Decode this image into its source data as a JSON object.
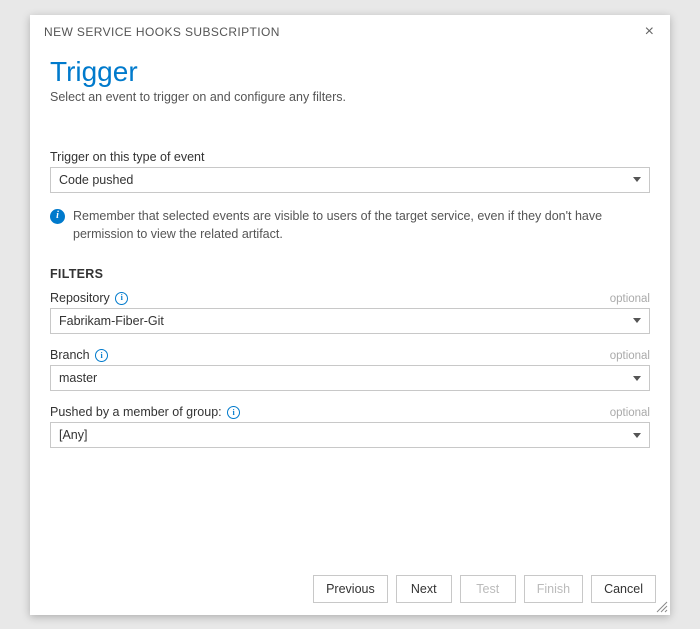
{
  "dialog": {
    "title": "NEW SERVICE HOOKS SUBSCRIPTION",
    "close": "×"
  },
  "page": {
    "heading": "Trigger",
    "subtext": "Select an event to trigger on and configure any filters."
  },
  "event": {
    "label": "Trigger on this type of event",
    "value": "Code pushed"
  },
  "info_banner": "Remember that selected events are visible to users of the target service, even if they don't have permission to view the related artifact.",
  "filters": {
    "heading": "FILTERS",
    "optional_label": "optional",
    "repository": {
      "label": "Repository",
      "value": "Fabrikam-Fiber-Git"
    },
    "branch": {
      "label": "Branch",
      "value": "master"
    },
    "group": {
      "label": "Pushed by a member of group:",
      "value": "[Any]"
    }
  },
  "buttons": {
    "previous": "Previous",
    "next": "Next",
    "test": "Test",
    "finish": "Finish",
    "cancel": "Cancel"
  }
}
